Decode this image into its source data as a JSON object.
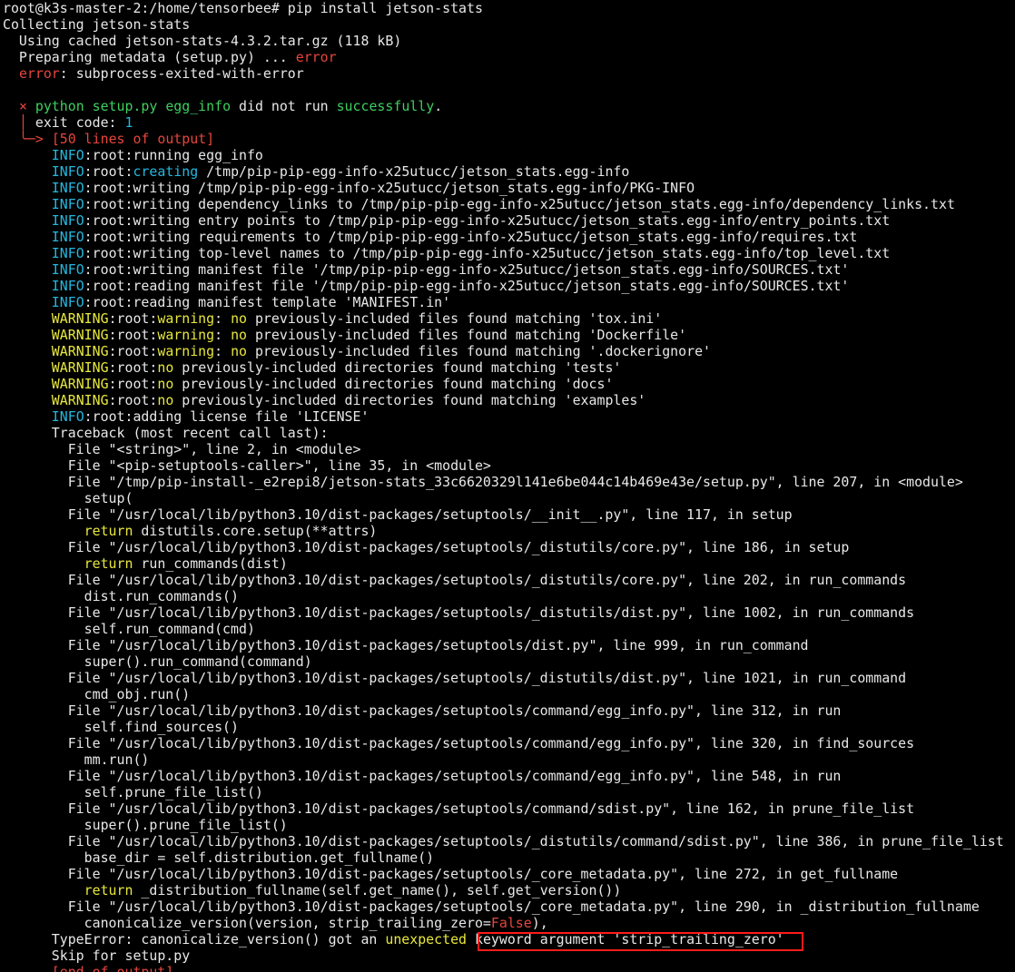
{
  "terminal": {
    "lines": [
      [
        [
          "default",
          "root@k3s-master-2:/home/tensorbee# pip install jetson-stats"
        ]
      ],
      [
        [
          "default",
          "Collecting jetson-stats"
        ]
      ],
      [
        [
          "default",
          "  Using cached jetson-stats-4.3.2.tar.gz (118 kB)"
        ]
      ],
      [
        [
          "default",
          "  Preparing metadata (setup.py) ... "
        ],
        [
          "red",
          "error"
        ]
      ],
      [
        [
          "default",
          "  "
        ],
        [
          "red",
          "error"
        ],
        [
          "default",
          ": subprocess-exited-with-error"
        ]
      ],
      [
        [
          "default",
          ""
        ]
      ],
      [
        [
          "default",
          "  "
        ],
        [
          "red",
          "×"
        ],
        [
          "default",
          " "
        ],
        [
          "green",
          "python setup.py egg_info"
        ],
        [
          "default",
          " did not run "
        ],
        [
          "green",
          "successfully"
        ],
        [
          "default",
          "."
        ]
      ],
      [
        [
          "default",
          "  "
        ],
        [
          "red",
          "│"
        ],
        [
          "default",
          " exit code: "
        ],
        [
          "cyan",
          "1"
        ]
      ],
      [
        [
          "default",
          "  "
        ],
        [
          "red",
          "╰─>"
        ],
        [
          "default",
          " "
        ],
        [
          "red",
          "[50 lines of output]"
        ]
      ],
      [
        [
          "default",
          "      "
        ],
        [
          "cyan",
          "INFO"
        ],
        [
          "default",
          ":root:running egg_info"
        ]
      ],
      [
        [
          "default",
          "      "
        ],
        [
          "cyan",
          "INFO"
        ],
        [
          "default",
          ":root:"
        ],
        [
          "cyan",
          "creating"
        ],
        [
          "default",
          " /tmp/pip-pip-egg-info-x25utucc/jetson_stats.egg-info"
        ]
      ],
      [
        [
          "default",
          "      "
        ],
        [
          "cyan",
          "INFO"
        ],
        [
          "default",
          ":root:writing /tmp/pip-pip-egg-info-x25utucc/jetson_stats.egg-info/PKG-INFO"
        ]
      ],
      [
        [
          "default",
          "      "
        ],
        [
          "cyan",
          "INFO"
        ],
        [
          "default",
          ":root:writing dependency_links to /tmp/pip-pip-egg-info-x25utucc/jetson_stats.egg-info/dependency_links.txt"
        ]
      ],
      [
        [
          "default",
          "      "
        ],
        [
          "cyan",
          "INFO"
        ],
        [
          "default",
          ":root:writing entry points to /tmp/pip-pip-egg-info-x25utucc/jetson_stats.egg-info/entry_points.txt"
        ]
      ],
      [
        [
          "default",
          "      "
        ],
        [
          "cyan",
          "INFO"
        ],
        [
          "default",
          ":root:writing requirements to /tmp/pip-pip-egg-info-x25utucc/jetson_stats.egg-info/requires.txt"
        ]
      ],
      [
        [
          "default",
          "      "
        ],
        [
          "cyan",
          "INFO"
        ],
        [
          "default",
          ":root:writing top-level names to /tmp/pip-pip-egg-info-x25utucc/jetson_stats.egg-info/top_level.txt"
        ]
      ],
      [
        [
          "default",
          "      "
        ],
        [
          "cyan",
          "INFO"
        ],
        [
          "default",
          ":root:writing manifest file '/tmp/pip-pip-egg-info-x25utucc/jetson_stats.egg-info/SOURCES.txt'"
        ]
      ],
      [
        [
          "default",
          "      "
        ],
        [
          "cyan",
          "INFO"
        ],
        [
          "default",
          ":root:reading manifest file '/tmp/pip-pip-egg-info-x25utucc/jetson_stats.egg-info/SOURCES.txt'"
        ]
      ],
      [
        [
          "default",
          "      "
        ],
        [
          "cyan",
          "INFO"
        ],
        [
          "default",
          ":root:reading manifest template 'MANIFEST.in'"
        ]
      ],
      [
        [
          "default",
          "      "
        ],
        [
          "yellow",
          "WARNING"
        ],
        [
          "default",
          ":root:"
        ],
        [
          "yellow",
          "warning"
        ],
        [
          "default",
          ": "
        ],
        [
          "yellow",
          "no"
        ],
        [
          "default",
          " previously-included files found matching 'tox.ini'"
        ]
      ],
      [
        [
          "default",
          "      "
        ],
        [
          "yellow",
          "WARNING"
        ],
        [
          "default",
          ":root:"
        ],
        [
          "yellow",
          "warning"
        ],
        [
          "default",
          ": "
        ],
        [
          "yellow",
          "no"
        ],
        [
          "default",
          " previously-included files found matching 'Dockerfile'"
        ]
      ],
      [
        [
          "default",
          "      "
        ],
        [
          "yellow",
          "WARNING"
        ],
        [
          "default",
          ":root:"
        ],
        [
          "yellow",
          "warning"
        ],
        [
          "default",
          ": "
        ],
        [
          "yellow",
          "no"
        ],
        [
          "default",
          " previously-included files found matching '.dockerignore'"
        ]
      ],
      [
        [
          "default",
          "      "
        ],
        [
          "yellow",
          "WARNING"
        ],
        [
          "default",
          ":root:"
        ],
        [
          "yellow",
          "no"
        ],
        [
          "default",
          " previously-included directories found matching 'tests'"
        ]
      ],
      [
        [
          "default",
          "      "
        ],
        [
          "yellow",
          "WARNING"
        ],
        [
          "default",
          ":root:"
        ],
        [
          "yellow",
          "no"
        ],
        [
          "default",
          " previously-included directories found matching 'docs'"
        ]
      ],
      [
        [
          "default",
          "      "
        ],
        [
          "yellow",
          "WARNING"
        ],
        [
          "default",
          ":root:"
        ],
        [
          "yellow",
          "no"
        ],
        [
          "default",
          " previously-included directories found matching 'examples'"
        ]
      ],
      [
        [
          "default",
          "      "
        ],
        [
          "cyan",
          "INFO"
        ],
        [
          "default",
          ":root:adding license file 'LICENSE'"
        ]
      ],
      [
        [
          "default",
          "      Traceback (most recent call last):"
        ]
      ],
      [
        [
          "default",
          "        File \"<string>\", line 2, in <module>"
        ]
      ],
      [
        [
          "default",
          "        File \"<pip-setuptools-caller>\", line 35, in <module>"
        ]
      ],
      [
        [
          "default",
          "        File \"/tmp/pip-install-_e2repi8/jetson-stats_33c6620329l141e6be044c14b469e43e/setup.py\", line 207, in <module>"
        ]
      ],
      [
        [
          "default",
          "          setup("
        ]
      ],
      [
        [
          "default",
          "        File \"/usr/local/lib/python3.10/dist-packages/setuptools/__init__.py\", line 117, in setup"
        ]
      ],
      [
        [
          "default",
          "          "
        ],
        [
          "yellow",
          "return"
        ],
        [
          "default",
          " distutils.core.setup(**attrs)"
        ]
      ],
      [
        [
          "default",
          "        File \"/usr/local/lib/python3.10/dist-packages/setuptools/_distutils/core.py\", line 186, in setup"
        ]
      ],
      [
        [
          "default",
          "          "
        ],
        [
          "yellow",
          "return"
        ],
        [
          "default",
          " run_commands(dist)"
        ]
      ],
      [
        [
          "default",
          "        File \"/usr/local/lib/python3.10/dist-packages/setuptools/_distutils/core.py\", line 202, in run_commands"
        ]
      ],
      [
        [
          "default",
          "          dist.run_commands()"
        ]
      ],
      [
        [
          "default",
          "        File \"/usr/local/lib/python3.10/dist-packages/setuptools/_distutils/dist.py\", line 1002, in run_commands"
        ]
      ],
      [
        [
          "default",
          "          self.run_command(cmd)"
        ]
      ],
      [
        [
          "default",
          "        File \"/usr/local/lib/python3.10/dist-packages/setuptools/dist.py\", line 999, in run_command"
        ]
      ],
      [
        [
          "default",
          "          super().run_command(command)"
        ]
      ],
      [
        [
          "default",
          "        File \"/usr/local/lib/python3.10/dist-packages/setuptools/_distutils/dist.py\", line 1021, in run_command"
        ]
      ],
      [
        [
          "default",
          "          cmd_obj.run()"
        ]
      ],
      [
        [
          "default",
          "        File \"/usr/local/lib/python3.10/dist-packages/setuptools/command/egg_info.py\", line 312, in run"
        ]
      ],
      [
        [
          "default",
          "          self.find_sources()"
        ]
      ],
      [
        [
          "default",
          "        File \"/usr/local/lib/python3.10/dist-packages/setuptools/command/egg_info.py\", line 320, in find_sources"
        ]
      ],
      [
        [
          "default",
          "          mm.run()"
        ]
      ],
      [
        [
          "default",
          "        File \"/usr/local/lib/python3.10/dist-packages/setuptools/command/egg_info.py\", line 548, in run"
        ]
      ],
      [
        [
          "default",
          "          self.prune_file_list()"
        ]
      ],
      [
        [
          "default",
          "        File \"/usr/local/lib/python3.10/dist-packages/setuptools/command/sdist.py\", line 162, in prune_file_list"
        ]
      ],
      [
        [
          "default",
          "          super().prune_file_list()"
        ]
      ],
      [
        [
          "default",
          "        File \"/usr/local/lib/python3.10/dist-packages/setuptools/_distutils/command/sdist.py\", line 386, in prune_file_list"
        ]
      ],
      [
        [
          "default",
          "          base_dir = self.distribution.get_fullname()"
        ]
      ],
      [
        [
          "default",
          "        File \"/usr/local/lib/python3.10/dist-packages/setuptools/_core_metadata.py\", line 272, in get_fullname"
        ]
      ],
      [
        [
          "default",
          "          "
        ],
        [
          "yellow",
          "return"
        ],
        [
          "default",
          " _distribution_fullname(self.get_name(), self.get_version())"
        ]
      ],
      [
        [
          "default",
          "        File \"/usr/local/lib/python3.10/dist-packages/setuptools/_core_metadata.py\", line 290, in _distribution_fullname"
        ]
      ],
      [
        [
          "default",
          "          canonicalize_version(version, strip_trailing_zero="
        ],
        [
          "red",
          "False"
        ],
        [
          "default",
          "),"
        ]
      ],
      [
        [
          "default",
          "      TypeError: canonicalize_version() got an "
        ],
        [
          "yellow",
          "unexpected"
        ],
        [
          "default",
          " keyword argument 'strip_trailing_zero'"
        ]
      ],
      [
        [
          "default",
          "      Skip for setup.py"
        ]
      ],
      [
        [
          "red",
          "      [end of output]"
        ]
      ]
    ]
  },
  "colors": {
    "background": "#000000",
    "default": "#e8e8e8",
    "red": "#e8453c",
    "green": "#3fcf5e",
    "cyan": "#24b8e0",
    "yellow": "#e8e83c",
    "highlight": "#ff1a1a"
  }
}
